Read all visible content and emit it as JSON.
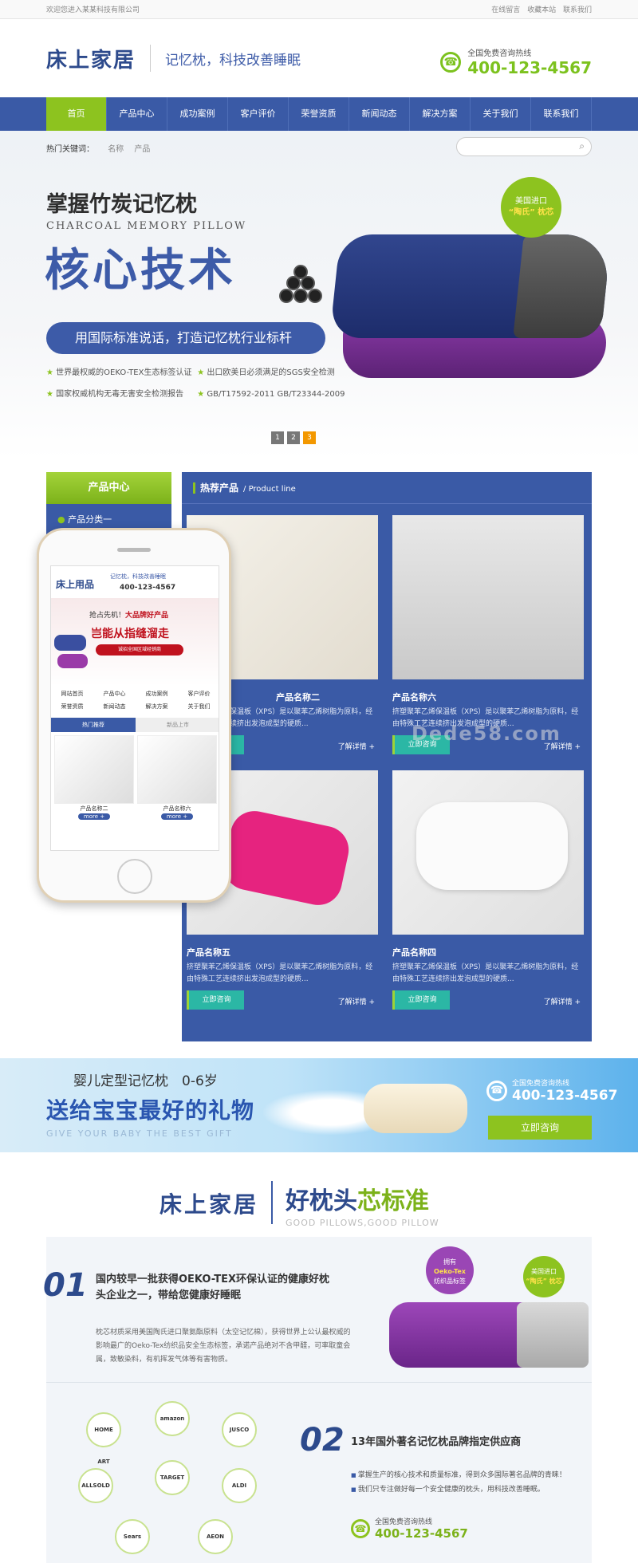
{
  "topbar": {
    "welcome": "欢迎您进入某某科技有限公司",
    "links": [
      "在线留言",
      "收藏本站",
      "联系我们"
    ]
  },
  "header": {
    "logo": "床上家居",
    "slogan": "记忆枕，科技改善睡眠",
    "hotline_label": "全国免费咨询热线",
    "hotline": "400-123-4567"
  },
  "nav": [
    "首页",
    "产品中心",
    "成功案例",
    "客户评价",
    "荣誉资质",
    "新闻动态",
    "解决方案",
    "关于我们",
    "联系我们"
  ],
  "hot": {
    "label": "热门关键词：",
    "items": [
      "名称",
      "产品"
    ]
  },
  "banner": {
    "title1": "掌握竹炭记忆枕",
    "title2": "CHARCOAL MEMORY PILLOW",
    "title3": "核心技术",
    "pill": "用国际标准说话，打造记忆枕行业标杆",
    "features": [
      "世界最权威的OEKO-TEX生态标签认证",
      "出口欧美日必须满足的SGS安全检测",
      "国家权威机构无毒无害安全检测报告",
      "GB/T17592-2011 GB/T23344-2009"
    ],
    "badge_top": "美国进口",
    "badge_bottom": "“陶氏” 枕芯",
    "dots": [
      "1",
      "2",
      "3"
    ]
  },
  "sidebar": {
    "title": "产品中心",
    "item": "产品分类一"
  },
  "products": {
    "title": "热荐产品",
    "subtitle": "/ Product line",
    "desc": "挤塑聚苯乙烯保温板（XPS）是以聚苯乙烯树脂为原料，经由特殊工艺连续挤出发泡成型的硬质...",
    "btn": "立即咨询",
    "more": "了解详情 +",
    "items": [
      {
        "name": "产品名称二"
      },
      {
        "name": "产品名称六"
      },
      {
        "name": "产品名称五"
      },
      {
        "name": "产品名称四"
      }
    ]
  },
  "watermark": "Dede58.com",
  "mobile": {
    "logo": "床上用品",
    "slogan": "记忆枕，科技改善睡眠",
    "phone": "400-123-4567",
    "t1a": "抢占先机！",
    "t1b": "大品牌好产品",
    "t2": "岂能从指缝溜走",
    "t3": "诚招全国区域经销商",
    "nav": [
      "网站首页",
      "产品中心",
      "成功案例",
      "客户评价",
      "荣誉资质",
      "新闻动态",
      "解决方案",
      "关于我们"
    ],
    "tab1": "热门推荐",
    "tab2": "新品上市",
    "c1": "产品名称二",
    "c2": "产品名称六",
    "more": "more +"
  },
  "baby": {
    "t1": "婴儿定型记忆枕　0-6岁",
    "t2": "送给宝宝最好的礼物",
    "t3": "GIVE YOUR BABY THE BEST GIFT",
    "hotline_label": "全国免费咨询热线",
    "hotline": "400-123-4567",
    "btn": "立即咨询"
  },
  "std": {
    "logo": "床上家居",
    "h2a": "好枕头",
    "h2b": "芯标准",
    "sub": "GOOD PILLOWS,GOOD PILLOW",
    "n1": "01",
    "h1": "国内较早一批获得OEKO-TEX环保认证的健康好枕头企业之一，带给您健康好睡眠",
    "d1": "枕芯材质采用美国陶氏进口聚氨酯原料（太空记忆棉），获得世界上公认最权威的影响最广的Oeko-Tex纺织品安全生态标签，承诺产品绝对不含甲醛，可率取童会属，致敏染料，有机挥发气体等有害物质。",
    "b1_top": "拥有",
    "b1_mid": "Oeko-Tex",
    "b1_bot": "纺织品标签",
    "b2_top": "美国进口",
    "b2_bot": "“陶氏” 枕芯",
    "n2": "02",
    "h2": "13年国外著名记忆枕品牌指定供应商",
    "list": [
      "掌握生产的核心技术和质量标准，得到众多国际著名品牌的青睐！",
      "我们只专注做好每一个安全健康的枕头，用科技改善睡眠。"
    ],
    "hotline_label": "全国免费咨询热线",
    "hotline": "400-123-4567",
    "brands": [
      "HOME ART",
      "amazon",
      "JUSCO",
      "ALLSOLD",
      "TARGET",
      "ALDI",
      "Sears",
      "AEON"
    ]
  }
}
